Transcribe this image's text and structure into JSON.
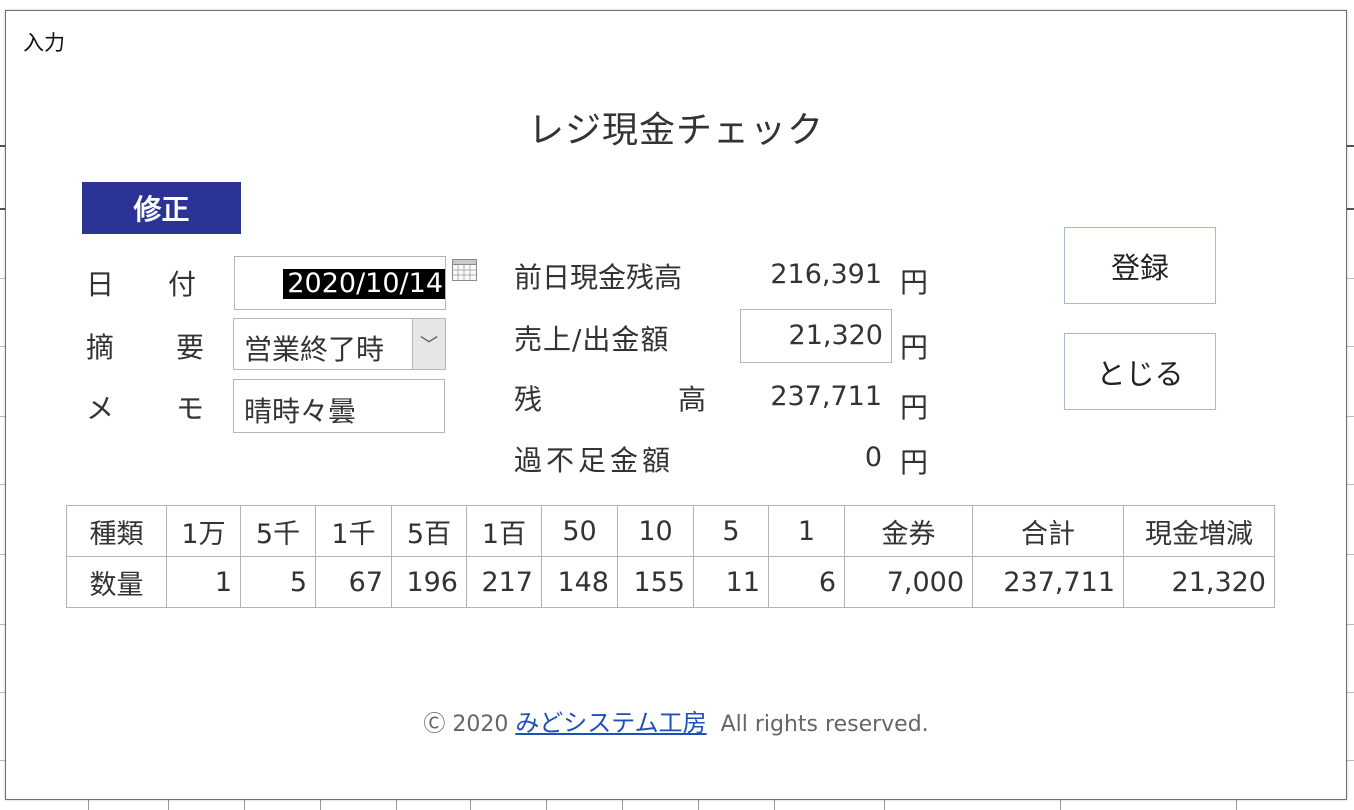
{
  "dialog": {
    "title": "入力",
    "form_title": "レジ現金チェック",
    "mode_badge": "修正"
  },
  "form": {
    "date": {
      "label1": "日",
      "label2": "付",
      "value": "2020/10/14"
    },
    "summary": {
      "label1": "摘",
      "label2": "要",
      "value": "営業終了時"
    },
    "memo": {
      "label1": "メ",
      "label2": "モ",
      "value": "晴時々曇"
    }
  },
  "cash": {
    "prev_balance_label": "前日現金残高",
    "prev_balance_value": "216,391",
    "sales_label": "売上/出金額",
    "sales_value": "21,320",
    "balance_label1": "残",
    "balance_label2": "高",
    "balance_value": "237,711",
    "diff_label": "過不足金額",
    "diff_value": "0",
    "unit": "円"
  },
  "buttons": {
    "register": "登録",
    "close": "とじる"
  },
  "table": {
    "headers": [
      "種類",
      "1万",
      "5千",
      "1千",
      "5百",
      "1百",
      "50",
      "10",
      "5",
      "1",
      "金券",
      "合計",
      "現金増減"
    ],
    "quantities": [
      "数量",
      "1",
      "5",
      "67",
      "196",
      "217",
      "148",
      "155",
      "11",
      "6",
      "7,000",
      "237,711",
      "21,320"
    ]
  },
  "footer": {
    "copyright_prefix": "Ⓒ 2020",
    "company_link": "みどシステム工房",
    "rights": "All rights reserved."
  },
  "colors": {
    "badge_bg": "#2b3494",
    "link": "#1f4fb8"
  }
}
